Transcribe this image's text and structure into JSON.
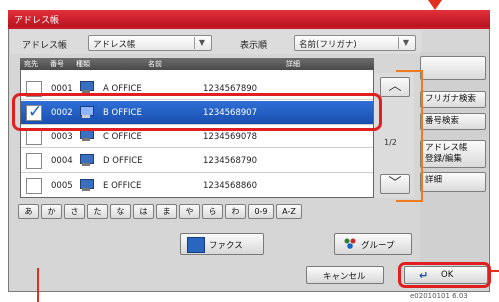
{
  "window": {
    "title": "アドレス帳"
  },
  "topbar": {
    "addressbook_label": "アドレス帳",
    "addressbook_value": "アドレス帳",
    "sort_label": "表示順",
    "sort_value": "名前(フリガナ)"
  },
  "table": {
    "headers": {
      "dest": "宛先",
      "number": "番号",
      "type": "種類",
      "name": "名前",
      "detail": "詳細"
    },
    "rows": [
      {
        "number": "0001",
        "name": "A OFFICE",
        "detail": "1234567890",
        "checked": false
      },
      {
        "number": "0002",
        "name": "B OFFICE",
        "detail": "1234568907",
        "checked": true
      },
      {
        "number": "0003",
        "name": "C OFFICE",
        "detail": "1234569078",
        "checked": false
      },
      {
        "number": "0004",
        "name": "D OFFICE",
        "detail": "1234568790",
        "checked": false
      },
      {
        "number": "0005",
        "name": "E OFFICE",
        "detail": "1234568860",
        "checked": false
      }
    ]
  },
  "pager": {
    "page": "1/2"
  },
  "side": {
    "furigana_search": "フリガナ検索",
    "number_search": "番号検索",
    "register_edit_line1": "アドレス帳",
    "register_edit_line2": "登録/編集",
    "detail": "詳細"
  },
  "kana_keys": [
    "あ",
    "か",
    "さ",
    "た",
    "な",
    "は",
    "ま",
    "や",
    "ら",
    "わ",
    "0-9",
    "A-Z"
  ],
  "filters": {
    "fax": "ファクス",
    "group": "グループ"
  },
  "footer": {
    "cancel": "キャンセル",
    "ok": "OK",
    "code": "e02010101 6.03"
  },
  "colors": {
    "title_red": "#c81c28",
    "selected_row": "#1a4fae",
    "highlight": "#e02020"
  }
}
